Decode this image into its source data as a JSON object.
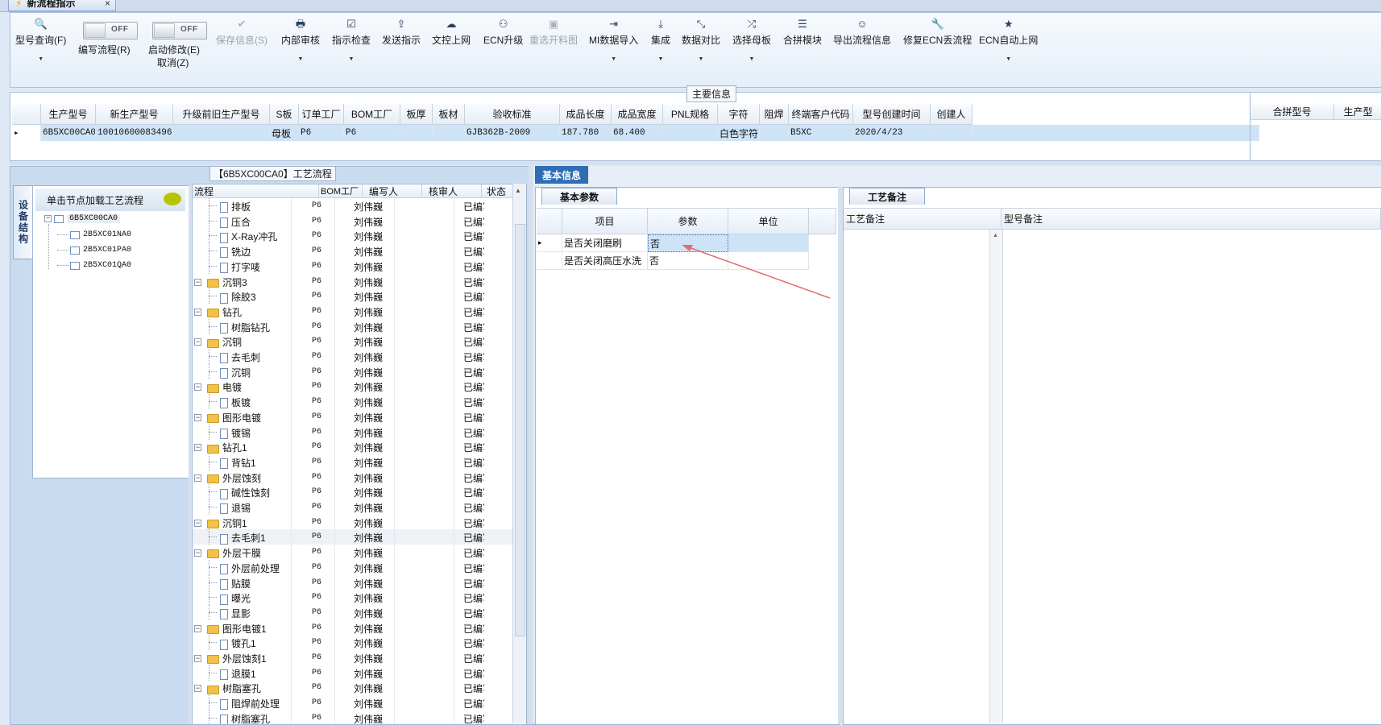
{
  "window": {
    "tab_title": "新流程指示",
    "close_glyph": "×"
  },
  "ribbon": {
    "buttons": [
      {
        "label": "型号查询(F)",
        "icon": "search-icon",
        "glyph": "🔍",
        "dropdown": true
      },
      {
        "label": "保存信息(S)",
        "icon": "save-icon",
        "glyph": "✔",
        "disabled": true
      },
      {
        "label": "内部审核",
        "icon": "print-icon",
        "glyph": "🖶",
        "dropdown": true
      },
      {
        "label": "指示检查",
        "icon": "checkbox-icon",
        "glyph": "☑",
        "dropdown": true
      },
      {
        "label": "发送指示",
        "icon": "upload-icon",
        "glyph": "⇪"
      },
      {
        "label": "文控上网",
        "icon": "cloud-upload-icon",
        "glyph": "☁"
      },
      {
        "label": "ECN升级",
        "icon": "users-icon",
        "glyph": "⚇"
      },
      {
        "label": "重选开料图",
        "icon": "image-icon",
        "glyph": "▣",
        "disabled": true
      },
      {
        "label": "MI数据导入",
        "icon": "import-icon",
        "glyph": "⇥",
        "dropdown": true
      },
      {
        "label": "集成",
        "icon": "download-icon",
        "glyph": "⤓",
        "dropdown": true
      },
      {
        "label": "数据对比",
        "icon": "compare-icon",
        "glyph": "⤡",
        "dropdown": true
      },
      {
        "label": "选择母板",
        "icon": "shuffle-icon",
        "glyph": "⤮",
        "dropdown": true
      },
      {
        "label": "合拼模块",
        "icon": "list-icon",
        "glyph": "☰"
      },
      {
        "label": "导出流程信息",
        "icon": "smile-icon",
        "glyph": "☺"
      },
      {
        "label": "修复ECN丢流程",
        "icon": "wrench-icon",
        "glyph": "🔧"
      },
      {
        "label": "ECN自动上网",
        "icon": "star-icon",
        "glyph": "★",
        "dropdown": true
      }
    ],
    "toggles": [
      {
        "state": "OFF",
        "label": "编写流程(R)"
      },
      {
        "state": "OFF",
        "label": "启动修改(E)",
        "label2": "取消(Z)"
      }
    ],
    "dropdown_glyph": "▼"
  },
  "main_info": {
    "section_label": "主要信息",
    "columns": [
      "生产型号",
      "新生产型号",
      "升级前旧生产型号",
      "S板",
      "订单工厂",
      "BOM工厂",
      "板厚",
      "板材",
      "验收标准",
      "成品长度",
      "成品宽度",
      "PNL规格",
      "字符",
      "阻焊",
      "终端客户代码",
      "型号创建时间",
      "创建人"
    ],
    "row": [
      "6B5XC00CA0",
      "10010600083496",
      "",
      "母板",
      "P6",
      "P6",
      "",
      "",
      "GJB362B-2009",
      "187.780",
      "68.400",
      "",
      "白色字符",
      "",
      "B5XC",
      "2020/4/23",
      ""
    ],
    "right_columns": [
      "合拼型号",
      "生产型"
    ]
  },
  "structure": {
    "side_tab": "设备结构",
    "hint": "单击节点加载工艺流程",
    "root": "6B5XC00CA0",
    "children": [
      "2B5XC01NA0",
      "2B5XC01PA0",
      "2B5XC01QA0"
    ]
  },
  "flow": {
    "title": "【6B5XC00CA0】工艺流程",
    "columns": [
      "流程",
      "BOM工厂",
      "编写人",
      "核审人",
      "状态"
    ],
    "rows": [
      {
        "name": "排板",
        "type": "file",
        "factory": "P6",
        "author": "刘伟巍",
        "status": "已编写"
      },
      {
        "name": "压合",
        "type": "file",
        "factory": "P6",
        "author": "刘伟巍",
        "status": "已编写"
      },
      {
        "name": "X-Ray冲孔",
        "type": "file",
        "factory": "P6",
        "author": "刘伟巍",
        "status": "已编写"
      },
      {
        "name": "铣边",
        "type": "file",
        "factory": "P6",
        "author": "刘伟巍",
        "status": "已编写"
      },
      {
        "name": "打字唛",
        "type": "file",
        "factory": "P6",
        "author": "刘伟巍",
        "status": "已编写"
      },
      {
        "name": "沉铜3",
        "type": "folder",
        "factory": "P6",
        "author": "刘伟巍",
        "status": "已编写"
      },
      {
        "name": "除胶3",
        "type": "file",
        "factory": "P6",
        "author": "刘伟巍",
        "status": "已编写"
      },
      {
        "name": "钻孔",
        "type": "folder",
        "factory": "P6",
        "author": "刘伟巍",
        "status": "已编写"
      },
      {
        "name": "树脂钻孔",
        "type": "file",
        "factory": "P6",
        "author": "刘伟巍",
        "status": "已编写"
      },
      {
        "name": "沉铜",
        "type": "folder",
        "factory": "P6",
        "author": "刘伟巍",
        "status": "已编写"
      },
      {
        "name": "去毛刺",
        "type": "file",
        "factory": "P6",
        "author": "刘伟巍",
        "status": "已编写"
      },
      {
        "name": "沉铜",
        "type": "file",
        "factory": "P6",
        "author": "刘伟巍",
        "status": "已编写"
      },
      {
        "name": "电镀",
        "type": "folder",
        "factory": "P6",
        "author": "刘伟巍",
        "status": "已编写"
      },
      {
        "name": "板镀",
        "type": "file",
        "factory": "P6",
        "author": "刘伟巍",
        "status": "已编写"
      },
      {
        "name": "图形电镀",
        "type": "folder",
        "factory": "P6",
        "author": "刘伟巍",
        "status": "已编写"
      },
      {
        "name": "镀锡",
        "type": "file",
        "factory": "P6",
        "author": "刘伟巍",
        "status": "已编写"
      },
      {
        "name": "钻孔1",
        "type": "folder",
        "factory": "P6",
        "author": "刘伟巍",
        "status": "已编写"
      },
      {
        "name": "背钻1",
        "type": "file",
        "factory": "P6",
        "author": "刘伟巍",
        "status": "已编写"
      },
      {
        "name": "外层蚀刻",
        "type": "folder",
        "factory": "P6",
        "author": "刘伟巍",
        "status": "已编写"
      },
      {
        "name": "碱性蚀刻",
        "type": "file",
        "factory": "P6",
        "author": "刘伟巍",
        "status": "已编写"
      },
      {
        "name": "退锡",
        "type": "file",
        "factory": "P6",
        "author": "刘伟巍",
        "status": "已编写"
      },
      {
        "name": "沉铜1",
        "type": "folder",
        "factory": "P6",
        "author": "刘伟巍",
        "status": "已编写"
      },
      {
        "name": "去毛刺1",
        "type": "file",
        "factory": "P6",
        "author": "刘伟巍",
        "status": "已编写",
        "selected": true
      },
      {
        "name": "外层干膜",
        "type": "folder",
        "factory": "P6",
        "author": "刘伟巍",
        "status": "已编写"
      },
      {
        "name": "外层前处理",
        "type": "file",
        "factory": "P6",
        "author": "刘伟巍",
        "status": "已编写"
      },
      {
        "name": "贴膜",
        "type": "file",
        "factory": "P6",
        "author": "刘伟巍",
        "status": "已编写"
      },
      {
        "name": "曝光",
        "type": "file",
        "factory": "P6",
        "author": "刘伟巍",
        "status": "已编写"
      },
      {
        "name": "显影",
        "type": "file",
        "factory": "P6",
        "author": "刘伟巍",
        "status": "已编写"
      },
      {
        "name": "图形电镀1",
        "type": "folder",
        "factory": "P6",
        "author": "刘伟巍",
        "status": "已编写"
      },
      {
        "name": "镀孔1",
        "type": "file",
        "factory": "P6",
        "author": "刘伟巍",
        "status": "已编写"
      },
      {
        "name": "外层蚀刻1",
        "type": "folder",
        "factory": "P6",
        "author": "刘伟巍",
        "status": "已编写"
      },
      {
        "name": "退膜1",
        "type": "file",
        "factory": "P6",
        "author": "刘伟巍",
        "status": "已编写"
      },
      {
        "name": "树脂塞孔",
        "type": "folder",
        "factory": "P6",
        "author": "刘伟巍",
        "status": "已编写"
      },
      {
        "name": "阻焊前处理",
        "type": "file",
        "factory": "P6",
        "author": "刘伟巍",
        "status": "已编写"
      },
      {
        "name": "树脂塞孔",
        "type": "file",
        "factory": "P6",
        "author": "刘伟巍",
        "status": "已编写"
      }
    ]
  },
  "basic_info": {
    "tab": "基本信息",
    "sub_tab": "基本参数",
    "columns": [
      "项目",
      "参数",
      "单位"
    ],
    "rows": [
      {
        "item": "是否关闭磨刷",
        "value": "否",
        "unit": ""
      },
      {
        "item": "是否关闭高压水洗",
        "value": "否",
        "unit": ""
      }
    ]
  },
  "process_notes": {
    "tab": "工艺备注",
    "col1": "工艺备注",
    "col2": "型号备注"
  },
  "colors": {
    "accent": "#2f6db5",
    "selection": "#cfe3f7",
    "annotation_arrow": "#e07070"
  }
}
